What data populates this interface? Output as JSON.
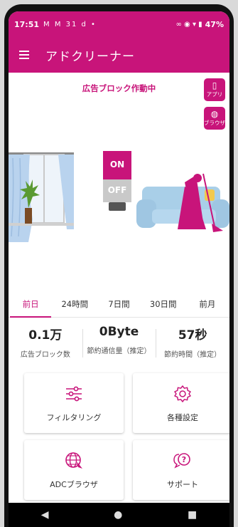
{
  "status_bar": {
    "time": "17:51",
    "notification_icons": "M M 31 d •",
    "right_icons": "∞ ◉ ▾ ▮",
    "battery": "47%"
  },
  "app_bar": {
    "title": "アドクリーナー"
  },
  "hero": {
    "ad_block_status": "広告ブロック作動中",
    "app_button_label": "アプリ",
    "browser_button_label": "ブラウザ",
    "toggle_on": "ON",
    "toggle_off": "OFF"
  },
  "tabs": [
    {
      "label": "前日",
      "active": true
    },
    {
      "label": "24時間",
      "active": false
    },
    {
      "label": "7日間",
      "active": false
    },
    {
      "label": "30日間",
      "active": false
    },
    {
      "label": "前月",
      "active": false
    }
  ],
  "stats": [
    {
      "value": "0.1万",
      "label": "広告ブロック数"
    },
    {
      "value": "0Byte",
      "label": "節約通信量（推定）"
    },
    {
      "value": "57秒",
      "label": "節約時間（推定）"
    }
  ],
  "cards": [
    {
      "label": "フィルタリング",
      "icon": "sliders-icon"
    },
    {
      "label": "各種設定",
      "icon": "gear-icon"
    },
    {
      "label": "ADCブラウザ",
      "icon": "browser-globe-icon"
    },
    {
      "label": "サポート",
      "icon": "support-chat-icon"
    }
  ],
  "colors": {
    "accent": "#c8147a",
    "curtain": "#b9d3ee",
    "sofa": "#a9cfe8"
  }
}
